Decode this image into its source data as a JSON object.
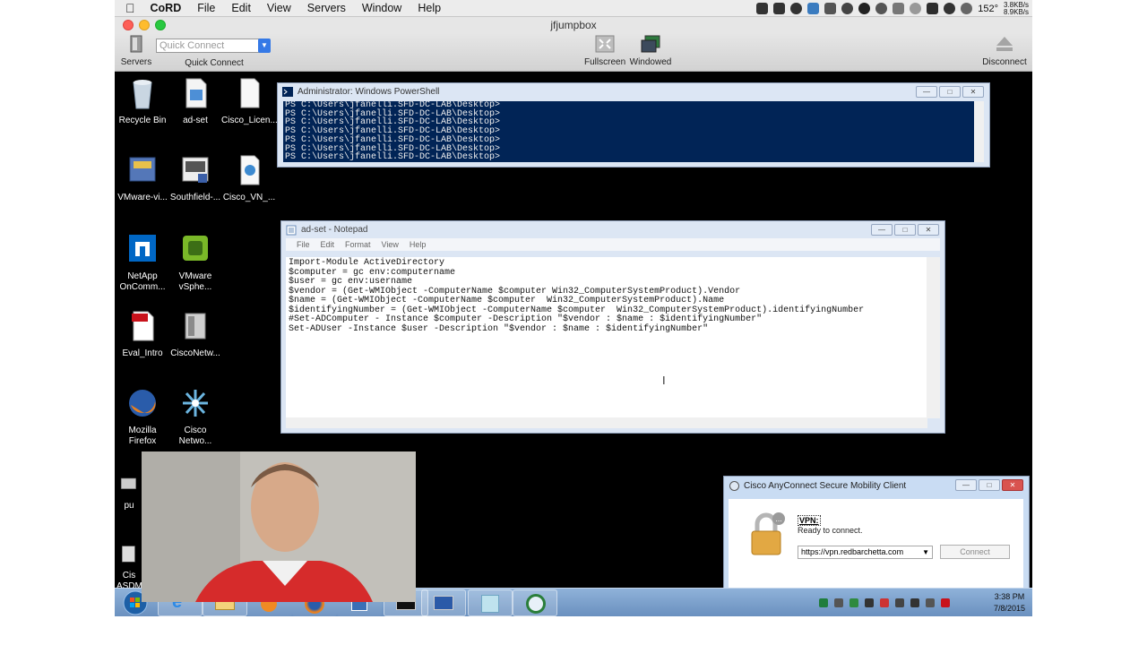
{
  "menubar": {
    "app": "CoRD",
    "menus": [
      "File",
      "Edit",
      "View",
      "Servers",
      "Window",
      "Help"
    ],
    "temperature": "152°",
    "net_up": "3.8KB/s",
    "net_down": "8.9KB/s"
  },
  "cord": {
    "window_title": "jfjumpbox",
    "servers_label": "Servers",
    "quick_connect_placeholder": "Quick Connect",
    "quick_connect_label": "Quick Connect",
    "fullscreen_label": "Fullscreen",
    "windowed_label": "Windowed",
    "disconnect_label": "Disconnect"
  },
  "desktop_icons": [
    {
      "label": "Recycle Bin"
    },
    {
      "label": "ad-set"
    },
    {
      "label": "Cisco_Licen..."
    },
    {
      "label": "VMware-vi..."
    },
    {
      "label": "Southfield-..."
    },
    {
      "label": "Cisco_VN_..."
    },
    {
      "label": "NetApp OnComm..."
    },
    {
      "label": "VMware vSphe..."
    },
    {
      "label": "Eval_Intro"
    },
    {
      "label": "CiscoNetw..."
    },
    {
      "label": "Mozilla Firefox"
    },
    {
      "label": "Cisco Netwo..."
    },
    {
      "label": "pu"
    },
    {
      "label": "Cis ASDM"
    }
  ],
  "powershell": {
    "title": "Administrator: Windows PowerShell",
    "lines": "PS C:\\Users\\jfanelli.SFD-DC-LAB\\Desktop>\nPS C:\\Users\\jfanelli.SFD-DC-LAB\\Desktop>\nPS C:\\Users\\jfanelli.SFD-DC-LAB\\Desktop>\nPS C:\\Users\\jfanelli.SFD-DC-LAB\\Desktop>\nPS C:\\Users\\jfanelli.SFD-DC-LAB\\Desktop>\nPS C:\\Users\\jfanelli.SFD-DC-LAB\\Desktop>\nPS C:\\Users\\jfanelli.SFD-DC-LAB\\Desktop>"
  },
  "notepad": {
    "title": "ad-set - Notepad",
    "menus": [
      "File",
      "Edit",
      "Format",
      "View",
      "Help"
    ],
    "content": "Import-Module ActiveDirectory\n$computer = gc env:computername\n$user = gc env:username\n$vendor = (Get-WMIObject -ComputerName $computer Win32_ComputerSystemProduct).Vendor\n$name = (Get-WMIObject -ComputerName $computer  Win32_ComputerSystemProduct).Name\n$identifyingNumber = (Get-WMIObject -ComputerName $computer  Win32_ComputerSystemProduct).identifyingNumber\n#Set-ADComputer - Instance $computer -Description \"$vendor : $name : $identifyingNumber\"\nSet-ADUser -Instance $user -Description \"$vendor : $name : $identifyingNumber\""
  },
  "anyconnect": {
    "title": "Cisco AnyConnect Secure Mobility Client",
    "vpn_label": "VPN:",
    "status": "Ready to connect.",
    "server_url": "https://vpn.redbarchetta.com",
    "connect_label": "Connect",
    "brand": "cisco"
  },
  "taskbar": {
    "time": "3:38 PM",
    "date": "7/8/2015"
  }
}
